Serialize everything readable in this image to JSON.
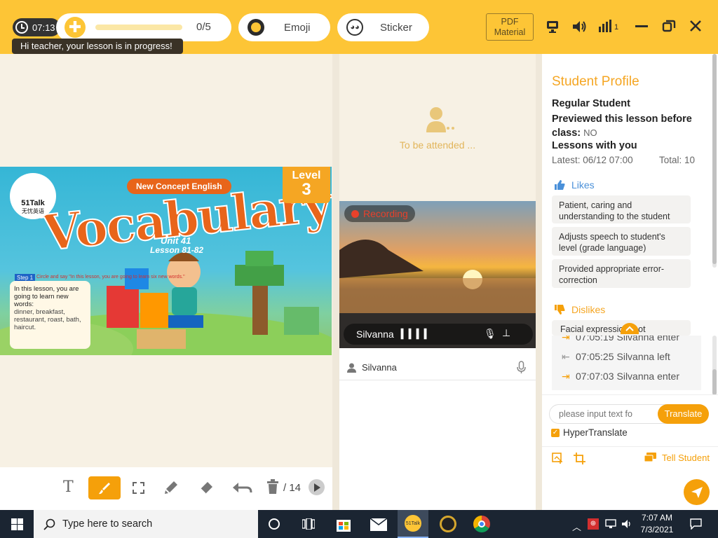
{
  "topbar": {
    "timer": "07:13",
    "tooltip": "Hi teacher, your lesson is in progress!",
    "stars_count": "0/5",
    "emoji_label": "Emoji",
    "sticker_label": "Sticker",
    "pdf_label_line1": "PDF",
    "pdf_label_line2": "Material",
    "signal_value": "1"
  },
  "slide": {
    "badge": "New Concept English",
    "level_word": "Level",
    "level_num": "3",
    "title": "Vocabulary",
    "unit": "Unit 41",
    "lessons": "Lesson 81-82",
    "logo_name": "51Talk",
    "logo_cn": "无忧英语",
    "step_label": "Step 1",
    "step_instruction": "Circle and say \"In this lesson, you are going to learn six new words.\"",
    "card_text": "In this lesson, you are going to learn new words:",
    "card_words": "dinner, breakfast, restaurant, roast, bath, haircut."
  },
  "toolbar": {
    "page_total": "/ 14"
  },
  "video": {
    "waiting_text": "To be attended ...",
    "recording_label": "Recording",
    "student_name": "Silvanna",
    "participant_name": "Silvanna"
  },
  "profile": {
    "title": "Student Profile",
    "student_type": "Regular Student",
    "previewed_label": "Previewed this lesson before class:",
    "previewed_value": "NO",
    "lessons_label": "Lessons with you",
    "latest": "Latest: 06/12 07:00",
    "total": "Total: 10",
    "likes_label": "Likes",
    "likes": [
      "Patient, caring and understanding to the student",
      "Adjusts speech to student's level (grade language)",
      "Provided appropriate error-correction"
    ],
    "dislikes_label": "Dislikes",
    "dislike_first": "Facial expressio... not"
  },
  "log": [
    {
      "time": "07:05:19",
      "text": "Silvanna enter",
      "type": "enter"
    },
    {
      "time": "07:05:25",
      "text": "Silvanna left",
      "type": "left"
    },
    {
      "time": "07:07:03",
      "text": "Silvanna enter",
      "type": "enter"
    }
  ],
  "chat": {
    "placeholder": "please input text fo",
    "translate_label": "Translate",
    "hypertranslate_label": "HyperTranslate",
    "tell_student_label": "Tell Student"
  },
  "taskbar": {
    "search_placeholder": "Type here to search",
    "time": "7:07 AM",
    "date": "7/3/2021",
    "app_label": "51Talk"
  },
  "colors": {
    "accent": "#fdc536",
    "orange": "#f5a00a",
    "profile_title": "#f5a623",
    "likes_blue": "#4a90d9",
    "recording_red": "#e8412b"
  }
}
